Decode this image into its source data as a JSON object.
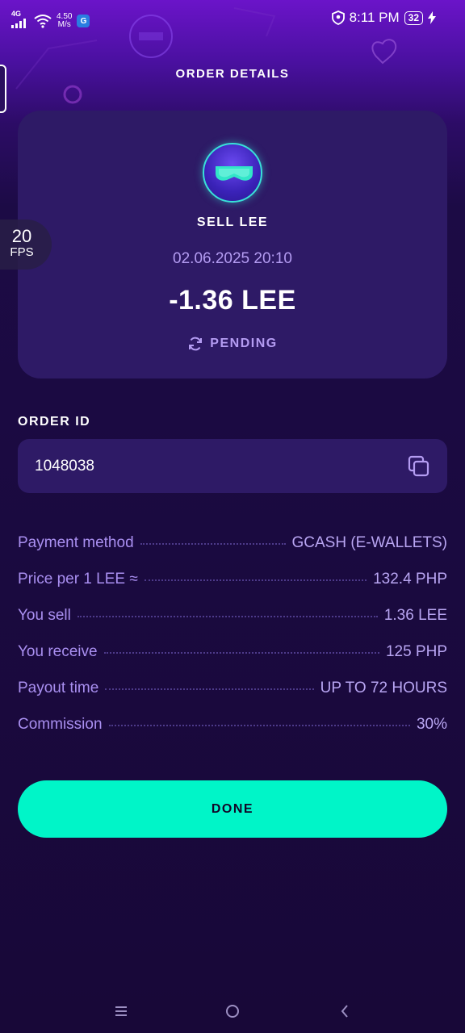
{
  "status_bar": {
    "network": "4G",
    "speed_value": "4.50",
    "speed_unit": "M/s",
    "app_badge": "G",
    "time": "8:11 PM",
    "battery": "32"
  },
  "header": {
    "title": "ORDER DETAILS"
  },
  "fps_overlay": {
    "value": "20",
    "label": "FPS"
  },
  "summary": {
    "title": "SELL LEE",
    "datetime": "02.06.2025 20:10",
    "amount": "-1.36 LEE",
    "status": "PENDING"
  },
  "order": {
    "label": "ORDER ID",
    "value": "1048038"
  },
  "details": [
    {
      "label": "Payment method",
      "value": "GCASH (E-WALLETS)"
    },
    {
      "label": "Price per 1 LEE ≈",
      "value": "132.4 PHP"
    },
    {
      "label": "You sell",
      "value": "1.36 LEE"
    },
    {
      "label": "You receive",
      "value": "125 PHP"
    },
    {
      "label": "Payout time",
      "value": "UP TO 72 HOURS"
    },
    {
      "label": "Commission",
      "value": "30%"
    }
  ],
  "actions": {
    "done_label": "DONE"
  },
  "icons": {
    "avatar": "sunglasses-avatar-icon",
    "status": "refresh-icon",
    "copy": "copy-icon",
    "nav": [
      "menu-icon",
      "home-circle-icon",
      "back-chevron-icon"
    ]
  },
  "colors": {
    "accent": "#00f5c8",
    "card": "#2e1a66",
    "muted_text": "#b49cf2"
  }
}
